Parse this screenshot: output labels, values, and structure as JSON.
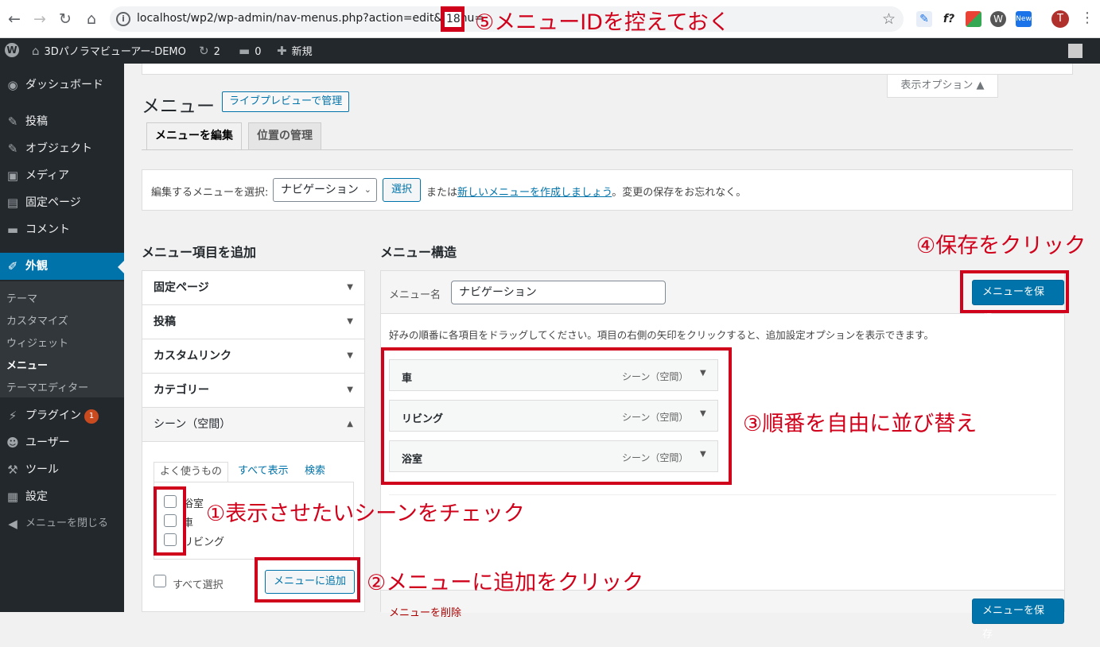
{
  "browser": {
    "url": "localhost/wp2/wp-admin/nav-menus.php?action=edit&menu=",
    "menu_id": "18",
    "back": "←",
    "forward": "→",
    "reload": "↻",
    "home": "⌂",
    "info": "i",
    "star": "☆",
    "kebab": "⋮",
    "avatar": "T",
    "ext_f": "f?",
    "ext_new": "New"
  },
  "adminbar": {
    "wp_logo": "W",
    "site": "3Dパノラマビューアー-DEMO",
    "updates": "2",
    "comments": "0",
    "new": "新規"
  },
  "sidebar": {
    "items": [
      {
        "label": "ダッシュボード",
        "icon": "dashboard-icon",
        "glyph": "◉"
      },
      {
        "label": "投稿",
        "icon": "pin-icon",
        "glyph": "✎"
      },
      {
        "label": "オブジェクト",
        "icon": "pin-icon",
        "glyph": "✎"
      },
      {
        "label": "メディア",
        "icon": "media-icon",
        "glyph": "▣"
      },
      {
        "label": "固定ページ",
        "icon": "page-icon",
        "glyph": "▤"
      },
      {
        "label": "コメント",
        "icon": "comment-icon",
        "glyph": "▬"
      },
      {
        "label": "外観",
        "icon": "brush-icon",
        "glyph": "✐"
      },
      {
        "label": "プラグイン",
        "icon": "plugin-icon",
        "glyph": "⚡",
        "badge": "1"
      },
      {
        "label": "ユーザー",
        "icon": "user-icon",
        "glyph": "☻"
      },
      {
        "label": "ツール",
        "icon": "wrench-icon",
        "glyph": "⚒"
      },
      {
        "label": "設定",
        "icon": "settings-icon",
        "glyph": "▦"
      },
      {
        "label": "メニューを閉じる",
        "icon": "collapse-icon",
        "glyph": "◀"
      }
    ],
    "submenu": [
      "テーマ",
      "カスタマイズ",
      "ウィジェット",
      "メニュー",
      "テーマエディター"
    ]
  },
  "page": {
    "screen_options": "表示オプション ▲",
    "title": "メニュー",
    "live_preview": "ライブプレビューで管理",
    "tab_edit": "メニューを編集",
    "tab_locations": "位置の管理"
  },
  "select": {
    "label": "編集するメニューを選択:",
    "value": "ナビゲーション",
    "chev": "⌄",
    "button": "選択",
    "or": "または",
    "link": "新しいメニューを作成しましょう",
    "tail": "。変更の保存をお忘れなく。"
  },
  "add_items": {
    "heading": "メニュー項目を追加",
    "sections": [
      "固定ページ",
      "投稿",
      "カスタムリンク",
      "カテゴリー",
      "シーン（空間）"
    ],
    "tabs": [
      "よく使うもの",
      "すべて表示",
      "検索"
    ],
    "scenes": [
      "浴室",
      "車",
      "リビング"
    ],
    "select_all": "すべて選択",
    "add_button": "メニューに追加",
    "tri_down": "▼",
    "tri_up": "▲"
  },
  "structure": {
    "heading": "メニュー構造",
    "name_label": "メニュー名",
    "name_value": "ナビゲーション",
    "save": "メニューを保存",
    "hint": "好みの順番に各項目をドラッグしてください。項目の右側の矢印をクリックすると、追加設定オプションを表示できます。",
    "items": [
      {
        "title": "車",
        "type": "シーン（空間）"
      },
      {
        "title": "リビング",
        "type": "シーン（空間）"
      },
      {
        "title": "浴室",
        "type": "シーン（空間）"
      }
    ],
    "delete": "メニューを削除"
  },
  "annotations": {
    "a1": "①表示させたいシーンをチェック",
    "a2": "②メニューに追加をクリック",
    "a3": "③順番を自由に並び替え",
    "a4": "④保存をクリック",
    "a5": "⑤メニューIDを控えておく"
  },
  "colors": {
    "accent": "#0073aa",
    "annotation": "#d0021b",
    "admin_dark": "#23282d"
  }
}
